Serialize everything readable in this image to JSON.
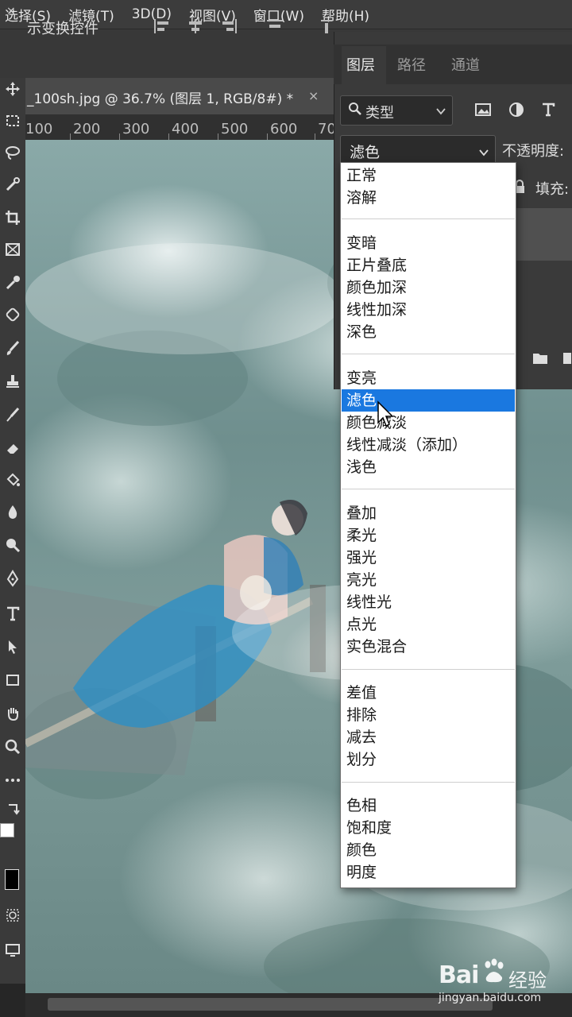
{
  "menubar": {
    "items": [
      "选择(S)",
      "滤镜(T)",
      "3D(D)",
      "视图(V)",
      "窗口(W)",
      "帮助(H)"
    ]
  },
  "options": {
    "close_glyph": "×",
    "transform_label": "示变换控件"
  },
  "document": {
    "title": "_100sh.jpg @ 36.7% (图层 1, RGB/8#) *",
    "close_glyph": "×",
    "ruler_marks": [
      "100",
      "200",
      "300",
      "400",
      "500",
      "600",
      "70"
    ]
  },
  "layers_panel": {
    "tabs": [
      "图层",
      "路径",
      "通道"
    ],
    "filter_label": "类型",
    "filter_icons": [
      "image-icon",
      "adjustment-icon",
      "text-icon"
    ],
    "blend_mode": "滤色",
    "opacity_label": "不透明度:",
    "fill_label": "填充:"
  },
  "blend_menu": {
    "groups": [
      [
        "正常",
        "溶解"
      ],
      [
        "变暗",
        "正片叠底",
        "颜色加深",
        "线性加深",
        "深色"
      ],
      [
        "变亮",
        "滤色",
        "颜色减淡",
        "线性减淡（添加）",
        "浅色"
      ],
      [
        "叠加",
        "柔光",
        "强光",
        "亮光",
        "线性光",
        "点光",
        "实色混合"
      ],
      [
        "差值",
        "排除",
        "减去",
        "划分"
      ],
      [
        "色相",
        "饱和度",
        "颜色",
        "明度"
      ]
    ],
    "selected": "滤色"
  },
  "watermark": {
    "brand_left": "Bai",
    "brand_right": "经验",
    "url": "jingyan.baidu.com"
  },
  "colors": {
    "menu_bg": "#3c3c3c",
    "panel_bg": "#3a3a3a",
    "highlight": "#1a78e0"
  }
}
